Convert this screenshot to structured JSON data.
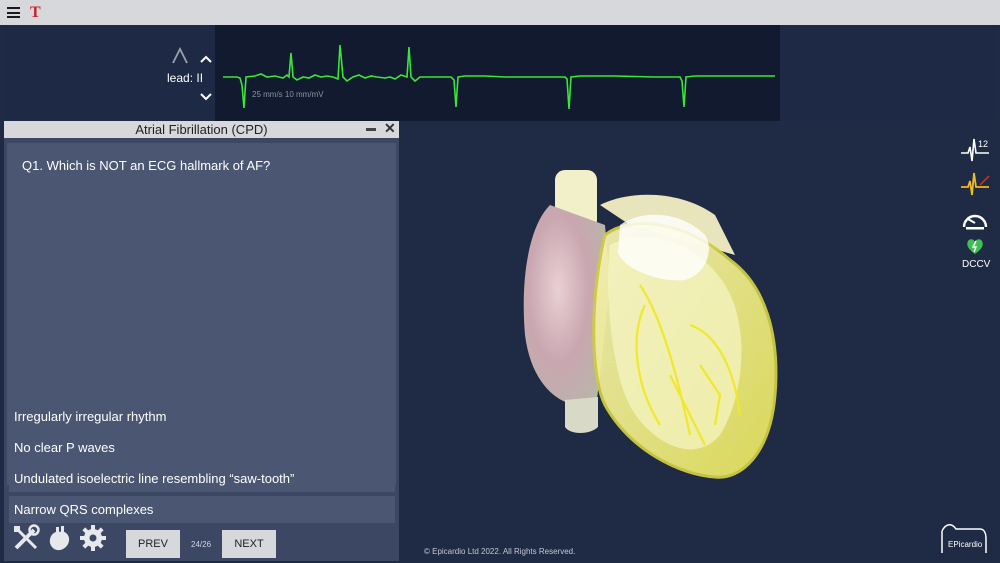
{
  "topbar": {
    "menu_icon": "hamburger-menu-icon",
    "text_tool_icon_label": "T"
  },
  "ecg": {
    "lead_label": "lead: II",
    "scale_text": "25 mm/s  10 mm/mV",
    "trace_color": "#39e639"
  },
  "quiz": {
    "title": "Atrial Fibrillation (CPD)",
    "question": "Q1. Which is NOT an ECG hallmark of AF?",
    "answers": [
      "Irregularly irregular rhythm",
      "No clear P waves",
      "Undulated isoelectric line resembling “saw-tooth”",
      "Narrow QRS complexes"
    ],
    "prev_label": "PREV",
    "next_label": "NEXT",
    "page_indicator": "24/26"
  },
  "sidebar": {
    "dccv_label": "DCCV",
    "icons": [
      "12-lead-ecg-icon",
      "ecg-strip-icon",
      "gauge-icon",
      "defibrillator-heart-icon"
    ]
  },
  "footer": {
    "copyright": "© Epicardio Ltd 2022. All Rights Reserved.",
    "logo_text": "EPicardio"
  }
}
